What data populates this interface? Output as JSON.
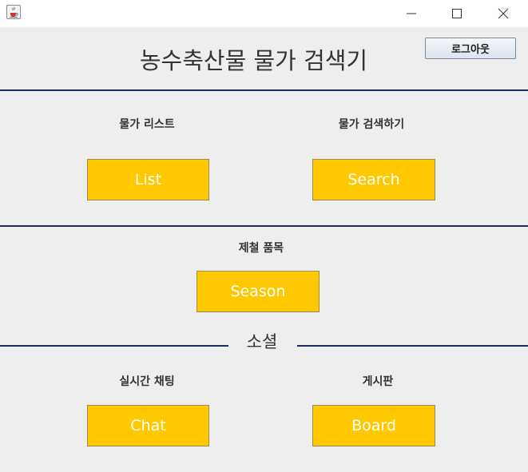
{
  "window": {
    "app_icon": "java-cup-icon",
    "controls": [
      "minimize-icon",
      "maximize-icon",
      "close-icon"
    ]
  },
  "header": {
    "title": "농수축산물 물가 검색기",
    "logout_label": "로그아웃"
  },
  "sections": {
    "price_list": {
      "label": "물가 리스트",
      "button": "List"
    },
    "price_search": {
      "label": "물가 검색하기",
      "button": "Search"
    },
    "seasonal": {
      "label": "제철 품목",
      "button": "Season"
    },
    "social": {
      "divider_label": "소셜"
    },
    "chat": {
      "label": "실시간 채팅",
      "button": "Chat"
    },
    "board": {
      "label": "게시판",
      "button": "Board"
    }
  },
  "colors": {
    "accent": "#ffc800",
    "divider": "#1d2a5c",
    "background": "#eeeeee"
  }
}
